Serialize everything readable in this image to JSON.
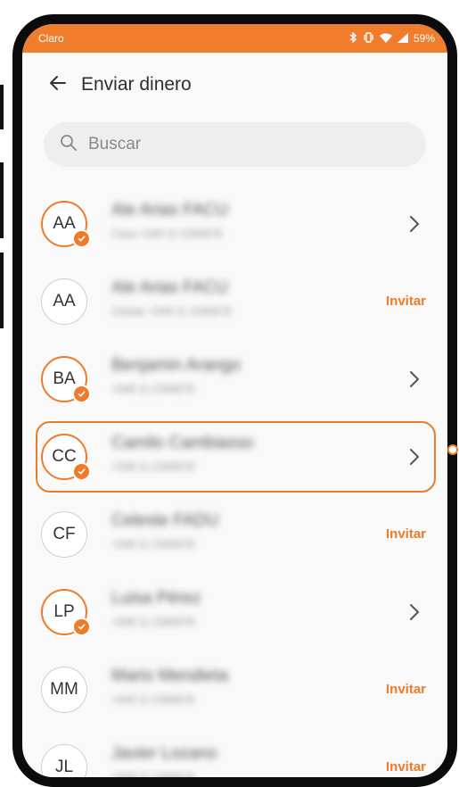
{
  "status_bar": {
    "carrier": "Claro",
    "battery": "59%",
    "icons": [
      "bluetooth-icon",
      "vibrate-icon",
      "wifi-icon",
      "signal-icon",
      "battery-icon"
    ]
  },
  "header": {
    "title": "Enviar dinero",
    "back_icon": "arrow-left-icon"
  },
  "search": {
    "placeholder": "Buscar",
    "value": ""
  },
  "contacts": [
    {
      "initials": "AA",
      "name": "Ale Arias FACU",
      "subtitle": "Casa +549 11 2345678",
      "verified": true,
      "action": "chevron"
    },
    {
      "initials": "AA",
      "name": "Ale Arias FACU",
      "subtitle": "Celular +549 11 2345678",
      "verified": false,
      "action": "invite"
    },
    {
      "initials": "BA",
      "name": "Benjamin Arango",
      "subtitle": "+549 11 2345678",
      "verified": true,
      "action": "chevron"
    },
    {
      "initials": "CC",
      "name": "Camilo Cambiasso",
      "subtitle": "+549 11 2345678",
      "verified": true,
      "action": "chevron",
      "selected": true
    },
    {
      "initials": "CF",
      "name": "Celeste FADU",
      "subtitle": "+549 11 2345678",
      "verified": false,
      "action": "invite"
    },
    {
      "initials": "LP",
      "name": "Luisa Pérez",
      "subtitle": "+549 11 2345678",
      "verified": true,
      "action": "chevron"
    },
    {
      "initials": "MM",
      "name": "Mario Mendieta",
      "subtitle": "+549 11 2345678",
      "verified": false,
      "action": "invite"
    },
    {
      "initials": "JL",
      "name": "Javier Lozano",
      "subtitle": "+549 11 2345678",
      "verified": false,
      "action": "invite"
    }
  ],
  "invite_label": "Invitar",
  "colors": {
    "accent": "#ef7b2a",
    "status_bar": "#f07c2c",
    "background": "#f9f9f9",
    "search_bg": "#eeeeee"
  }
}
